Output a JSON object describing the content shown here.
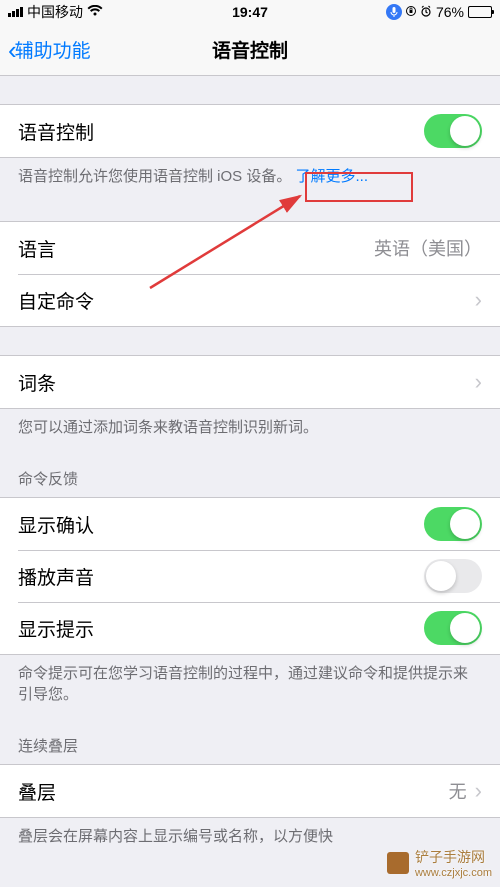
{
  "status": {
    "carrier": "中国移动",
    "time": "19:47",
    "battery_pct": "76%"
  },
  "nav": {
    "back_label": "辅助功能",
    "title": "语音控制"
  },
  "voice_control": {
    "row_label": "语音控制",
    "enabled": true,
    "footer": "语音控制允许您使用语音控制 iOS 设备。",
    "learn_more": "了解更多..."
  },
  "language": {
    "label": "语言",
    "value": "英语（美国）"
  },
  "custom_commands": {
    "label": "自定命令"
  },
  "vocabulary": {
    "label": "词条",
    "footer": "您可以通过添加词条来教语音控制识别新词。"
  },
  "feedback": {
    "header": "命令反馈",
    "show_confirm": {
      "label": "显示确认",
      "on": true
    },
    "play_sound": {
      "label": "播放声音",
      "on": false
    },
    "show_hints": {
      "label": "显示提示",
      "on": true
    },
    "footer": "命令提示可在您学习语音控制的过程中，通过建议命令和提供提示来引导您。"
  },
  "overlay": {
    "header": "连续叠层",
    "label": "叠层",
    "value": "无",
    "footer": "叠层会在屏幕内容上显示编号或名称，以方便快"
  },
  "watermark": {
    "text": "铲子手游网",
    "url": "www.czjxjc.com"
  }
}
